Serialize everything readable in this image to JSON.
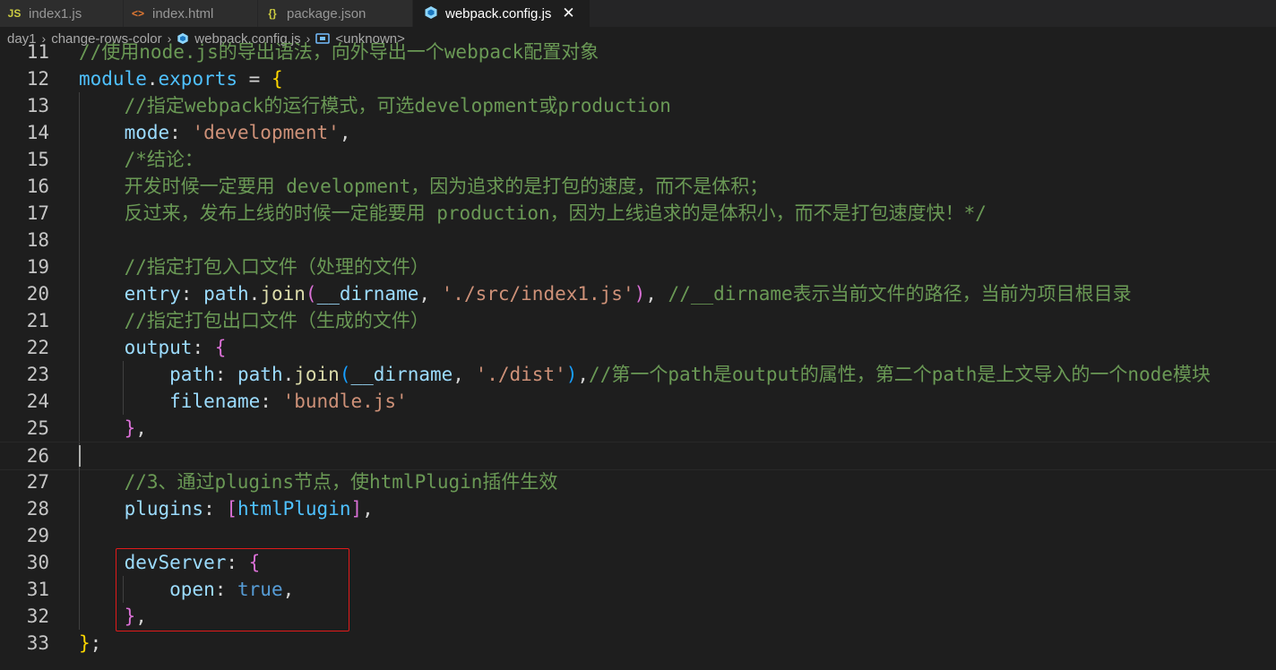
{
  "tabs": [
    {
      "label": "index1.js",
      "icon": "js-file-icon",
      "icon_text": "JS",
      "icon_color": "#cbcb41",
      "active": false
    },
    {
      "label": "index.html",
      "icon": "html-file-icon",
      "icon_text": "<>",
      "icon_color": "#e37933",
      "active": false
    },
    {
      "label": "package.json",
      "icon": "json-file-icon",
      "icon_text": "{}",
      "icon_color": "#cbcb41",
      "active": false
    },
    {
      "label": "webpack.config.js",
      "icon": "webpack-icon",
      "icon_text": "",
      "icon_color": "#519aba",
      "active": true,
      "close": "✕"
    }
  ],
  "breadcrumb": {
    "items": [
      "day1",
      "change-rows-color",
      "webpack.config.js",
      "<unknown>"
    ],
    "separator": "›"
  },
  "editor": {
    "line_numbers": [
      "11",
      "12",
      "13",
      "14",
      "15",
      "16",
      "17",
      "18",
      "19",
      "20",
      "21",
      "22",
      "23",
      "24",
      "25",
      "26",
      "27",
      "28",
      "29",
      "30",
      "31",
      "32",
      "33"
    ],
    "lines": [
      [
        {
          "t": "//使用node.js的导出语法，向外导出一个webpack配置对象",
          "c": "cm"
        }
      ],
      [
        {
          "t": "module",
          "c": "var"
        },
        {
          "t": ".",
          "c": "pun"
        },
        {
          "t": "exports",
          "c": "var"
        },
        {
          "t": " = ",
          "c": "pun"
        },
        {
          "t": "{",
          "c": "br1"
        }
      ],
      [
        {
          "t": "    //指定webpack的运行模式，可选development或production",
          "c": "cm"
        }
      ],
      [
        {
          "t": "    mode",
          "c": "prop"
        },
        {
          "t": ": ",
          "c": "pun"
        },
        {
          "t": "'development'",
          "c": "str"
        },
        {
          "t": ",",
          "c": "pun"
        }
      ],
      [
        {
          "t": "    /*结论：",
          "c": "cm"
        }
      ],
      [
        {
          "t": "    开发时候一定要用 development，因为追求的是打包的速度，而不是体积；",
          "c": "cm"
        }
      ],
      [
        {
          "t": "    反过来，发布上线的时候一定能要用 production，因为上线追求的是体积小，而不是打包速度快！*/",
          "c": "cm"
        }
      ],
      [],
      [
        {
          "t": "    //指定打包入口文件（处理的文件）",
          "c": "cm"
        }
      ],
      [
        {
          "t": "    entry",
          "c": "prop"
        },
        {
          "t": ": ",
          "c": "pun"
        },
        {
          "t": "path",
          "c": "prop"
        },
        {
          "t": ".",
          "c": "pun"
        },
        {
          "t": "join",
          "c": "fn"
        },
        {
          "t": "(",
          "c": "br2"
        },
        {
          "t": "__dirname",
          "c": "prop"
        },
        {
          "t": ", ",
          "c": "pun"
        },
        {
          "t": "'./src/index1.js'",
          "c": "str"
        },
        {
          "t": ")",
          "c": "br2"
        },
        {
          "t": ", ",
          "c": "pun"
        },
        {
          "t": "//__dirname表示当前文件的路径，当前为项目根目录",
          "c": "cm"
        }
      ],
      [
        {
          "t": "    //指定打包出口文件（生成的文件）",
          "c": "cm"
        }
      ],
      [
        {
          "t": "    output",
          "c": "prop"
        },
        {
          "t": ": ",
          "c": "pun"
        },
        {
          "t": "{",
          "c": "br2"
        }
      ],
      [
        {
          "t": "        path",
          "c": "prop"
        },
        {
          "t": ": ",
          "c": "pun"
        },
        {
          "t": "path",
          "c": "prop"
        },
        {
          "t": ".",
          "c": "pun"
        },
        {
          "t": "join",
          "c": "fn"
        },
        {
          "t": "(",
          "c": "br3"
        },
        {
          "t": "__dirname",
          "c": "prop"
        },
        {
          "t": ", ",
          "c": "pun"
        },
        {
          "t": "'./dist'",
          "c": "str"
        },
        {
          "t": ")",
          "c": "br3"
        },
        {
          "t": ",",
          "c": "pun"
        },
        {
          "t": "//第一个path是output的属性，第二个path是上文导入的一个node模块",
          "c": "cm"
        }
      ],
      [
        {
          "t": "        filename",
          "c": "prop"
        },
        {
          "t": ": ",
          "c": "pun"
        },
        {
          "t": "'bundle.js'",
          "c": "str"
        }
      ],
      [
        {
          "t": "    }",
          "c": "br2"
        },
        {
          "t": ",",
          "c": "pun"
        }
      ],
      [],
      [
        {
          "t": "    //3、通过plugins节点，使htmlPlugin插件生效",
          "c": "cm"
        }
      ],
      [
        {
          "t": "    plugins",
          "c": "prop"
        },
        {
          "t": ": ",
          "c": "pun"
        },
        {
          "t": "[",
          "c": "br2"
        },
        {
          "t": "htmlPlugin",
          "c": "var"
        },
        {
          "t": "]",
          "c": "br2"
        },
        {
          "t": ",",
          "c": "pun"
        }
      ],
      [],
      [
        {
          "t": "    devServer",
          "c": "prop"
        },
        {
          "t": ": ",
          "c": "pun"
        },
        {
          "t": "{",
          "c": "br2"
        }
      ],
      [
        {
          "t": "        open",
          "c": "prop"
        },
        {
          "t": ": ",
          "c": "pun"
        },
        {
          "t": "true",
          "c": "kw"
        },
        {
          "t": ",",
          "c": "pun"
        }
      ],
      [
        {
          "t": "    }",
          "c": "br2"
        },
        {
          "t": ",",
          "c": "pun"
        }
      ],
      [
        {
          "t": "}",
          "c": "br1"
        },
        {
          "t": ";",
          "c": "pun"
        }
      ]
    ],
    "cursor_line": "26"
  },
  "colors": {
    "background": "#1e1e1e",
    "comment": "#6a9955",
    "property": "#9cdcfe",
    "string": "#ce9178",
    "keyword": "#569cd6",
    "highlight_box": "#e11a1a"
  }
}
